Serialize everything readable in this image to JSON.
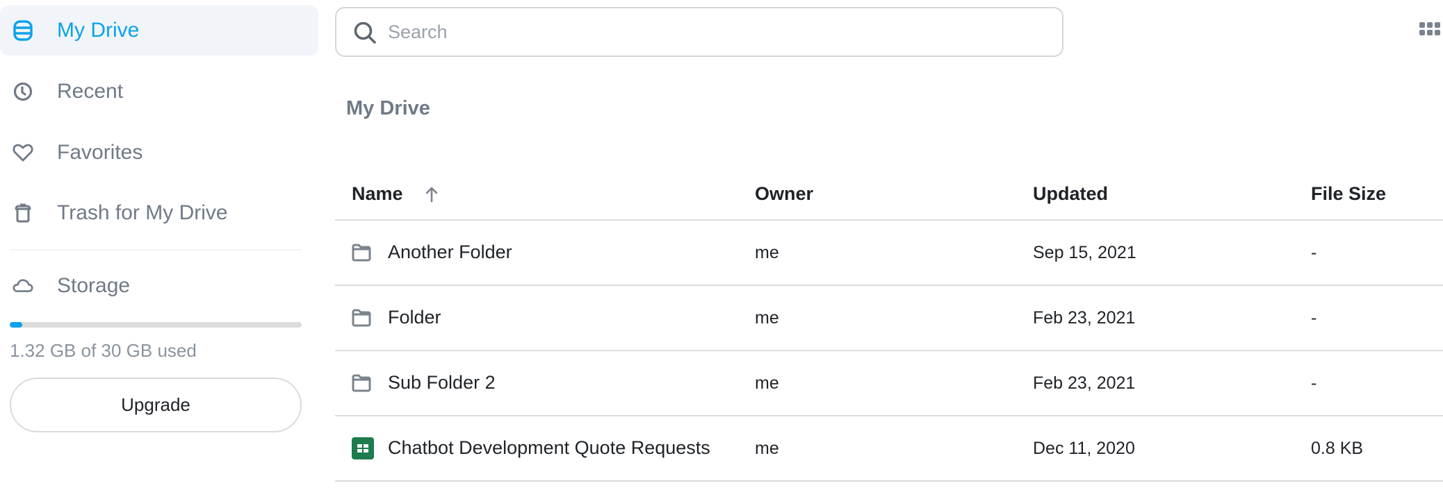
{
  "sidebar": {
    "items": [
      {
        "label": "My Drive",
        "icon": "database-icon",
        "active": true
      },
      {
        "label": "Recent",
        "icon": "clock-icon",
        "active": false
      },
      {
        "label": "Favorites",
        "icon": "heart-icon",
        "active": false
      },
      {
        "label": "Trash for My Drive",
        "icon": "trash-icon",
        "active": false
      }
    ],
    "storage": {
      "label": "Storage",
      "icon": "cloud-icon",
      "used_gb": 1.32,
      "total_gb": 30,
      "used_fraction": 0.044,
      "text": "1.32 GB of 30 GB used",
      "upgrade_label": "Upgrade"
    }
  },
  "search": {
    "placeholder": "Search",
    "value": ""
  },
  "page": {
    "title": "My Drive"
  },
  "table": {
    "columns": [
      "Name",
      "Owner",
      "Updated",
      "File Size"
    ],
    "sort": {
      "column": "Name",
      "direction": "ascending"
    },
    "rows": [
      {
        "type": "folder",
        "icon": "folder-icon",
        "name": "Another Folder",
        "owner": "me",
        "updated": "Sep 15, 2021",
        "size": "-"
      },
      {
        "type": "folder",
        "icon": "folder-icon",
        "name": "Folder",
        "owner": "me",
        "updated": "Feb 23, 2021",
        "size": "-"
      },
      {
        "type": "folder",
        "icon": "folder-icon",
        "name": "Sub Folder 2",
        "owner": "me",
        "updated": "Feb 23, 2021",
        "size": "-"
      },
      {
        "type": "spreadsheet",
        "icon": "spreadsheet-icon",
        "name": "Chatbot Development Quote Requests",
        "owner": "me",
        "updated": "Dec 11, 2020",
        "size": "0.8 KB"
      }
    ]
  },
  "colors": {
    "accent": "#0aa2ec",
    "active_bg": "#f1f4f8",
    "muted_text": "#707a86",
    "spreadsheet_green": "#1e7b4e"
  }
}
